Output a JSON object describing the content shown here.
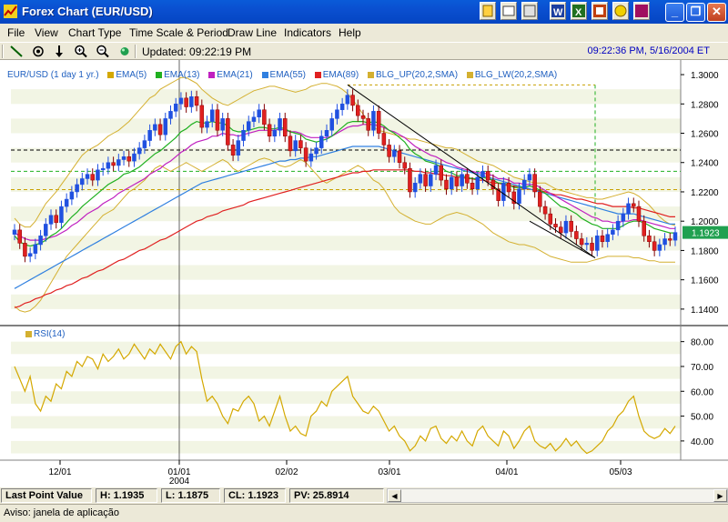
{
  "window": {
    "title": "Forex Chart (EUR/USD)"
  },
  "menu": [
    "File",
    "View",
    "Chart Type",
    "Time Scale & Period",
    "Draw Line",
    "Indicators",
    "Help"
  ],
  "toolbar": {
    "updated": "Updated: 09:22:19 PM",
    "clock": "09:22:36 PM, 5/16/2004 ET"
  },
  "legend": [
    {
      "label": "EUR/USD (1 day  1 yr.)",
      "color": "#2060c0"
    },
    {
      "label": "EMA(5)",
      "color": "#d4a800"
    },
    {
      "label": "EMA(13)",
      "color": "#20b020"
    },
    {
      "label": "EMA(21)",
      "color": "#c020c0"
    },
    {
      "label": "EMA(55)",
      "color": "#3080e0"
    },
    {
      "label": "EMA(89)",
      "color": "#e02020"
    },
    {
      "label": "BLG_UP(20,2,SMA)",
      "color": "#d4b030"
    },
    {
      "label": "BLG_LW(20,2,SMA)",
      "color": "#d4b030"
    }
  ],
  "rsi_label": "RSI(14)",
  "chart_data": [
    {
      "type": "line",
      "title": "EUR/USD (1 day  1 yr.)",
      "price_ticks": [
        "1.3000",
        "1.2800",
        "1.2600",
        "1.2400",
        "1.2200",
        "1.2000",
        "1.1800",
        "1.1600",
        "1.1400"
      ],
      "ylim": [
        1.13,
        1.305
      ],
      "current_price": "1.1923",
      "x_ticks": [
        "12/01",
        "01/01",
        "02/02",
        "03/01",
        "04/01",
        "05/03"
      ],
      "x_year": "2004",
      "close": [
        1.194,
        1.185,
        1.176,
        1.178,
        1.184,
        1.19,
        1.198,
        1.204,
        1.199,
        1.21,
        1.215,
        1.22,
        1.225,
        1.229,
        1.232,
        1.228,
        1.235,
        1.236,
        1.24,
        1.238,
        1.242,
        1.244,
        1.241,
        1.246,
        1.25,
        1.255,
        1.262,
        1.266,
        1.259,
        1.27,
        1.275,
        1.28,
        1.284,
        1.278,
        1.285,
        1.279,
        1.264,
        1.268,
        1.276,
        1.262,
        1.27,
        1.252,
        1.245,
        1.255,
        1.262,
        1.268,
        1.271,
        1.276,
        1.266,
        1.258,
        1.262,
        1.27,
        1.258,
        1.248,
        1.255,
        1.25,
        1.241,
        1.246,
        1.25,
        1.258,
        1.262,
        1.27,
        1.276,
        1.28,
        1.286,
        1.279,
        1.272,
        1.27,
        1.262,
        1.275,
        1.26,
        1.252,
        1.244,
        1.248,
        1.24,
        1.236,
        1.22,
        1.226,
        1.232,
        1.224,
        1.232,
        1.238,
        1.228,
        1.222,
        1.23,
        1.224,
        1.232,
        1.226,
        1.222,
        1.23,
        1.234,
        1.228,
        1.222,
        1.214,
        1.226,
        1.22,
        1.212,
        1.222,
        1.228,
        1.232,
        1.22,
        1.21,
        1.205,
        1.198,
        1.196,
        1.192,
        1.2,
        1.193,
        1.188,
        1.184,
        1.185,
        1.18,
        1.19,
        1.186,
        1.191,
        1.194,
        1.2,
        1.205,
        1.212,
        1.21,
        1.2,
        1.19,
        1.186,
        1.18,
        1.184,
        1.188,
        1.187,
        1.1923
      ],
      "ema13": [
        1.19,
        1.186,
        1.184,
        1.183,
        1.184,
        1.185,
        1.187,
        1.19,
        1.192,
        1.195,
        1.199,
        1.203,
        1.206,
        1.21,
        1.213,
        1.216,
        1.219,
        1.222,
        1.225,
        1.227,
        1.229,
        1.232,
        1.233,
        1.235,
        1.237,
        1.24,
        1.243,
        1.246,
        1.248,
        1.251,
        1.254,
        1.257,
        1.261,
        1.263,
        1.266,
        1.268,
        1.267,
        1.267,
        1.268,
        1.267,
        1.267,
        1.265,
        1.262,
        1.261,
        1.261,
        1.262,
        1.263,
        1.264,
        1.264,
        1.263,
        1.263,
        1.264,
        1.263,
        1.261,
        1.26,
        1.259,
        1.256,
        1.255,
        1.254,
        1.255,
        1.256,
        1.258,
        1.261,
        1.264,
        1.267,
        1.268,
        1.268,
        1.268,
        1.267,
        1.268,
        1.267,
        1.265,
        1.262,
        1.26,
        1.257,
        1.254,
        1.249,
        1.246,
        1.244,
        1.241,
        1.24,
        1.239,
        1.237,
        1.234,
        1.233,
        1.231,
        1.231,
        1.23,
        1.229,
        1.229,
        1.23,
        1.229,
        1.228,
        1.226,
        1.226,
        1.225,
        1.223,
        1.223,
        1.223,
        1.224,
        1.223,
        1.221,
        1.219,
        1.216,
        1.213,
        1.21,
        1.209,
        1.207,
        1.205,
        1.202,
        1.2,
        1.198,
        1.197,
        1.195,
        1.195,
        1.195,
        1.195,
        1.197,
        1.199,
        1.2,
        1.2,
        1.199,
        1.197,
        1.195,
        1.194,
        1.193,
        1.192,
        1.192
      ],
      "ema21": [
        1.192,
        1.19,
        1.188,
        1.187,
        1.187,
        1.187,
        1.188,
        1.189,
        1.19,
        1.192,
        1.194,
        1.197,
        1.199,
        1.202,
        1.205,
        1.207,
        1.209,
        1.212,
        1.214,
        1.216,
        1.219,
        1.221,
        1.223,
        1.225,
        1.227,
        1.229,
        1.232,
        1.234,
        1.236,
        1.239,
        1.241,
        1.244,
        1.247,
        1.249,
        1.252,
        1.254,
        1.255,
        1.256,
        1.258,
        1.258,
        1.26,
        1.259,
        1.259,
        1.258,
        1.259,
        1.26,
        1.261,
        1.262,
        1.262,
        1.262,
        1.262,
        1.263,
        1.262,
        1.261,
        1.261,
        1.26,
        1.258,
        1.257,
        1.257,
        1.257,
        1.257,
        1.258,
        1.26,
        1.262,
        1.264,
        1.265,
        1.265,
        1.266,
        1.266,
        1.266,
        1.265,
        1.264,
        1.262,
        1.261,
        1.259,
        1.257,
        1.254,
        1.251,
        1.249,
        1.247,
        1.245,
        1.244,
        1.242,
        1.24,
        1.239,
        1.237,
        1.236,
        1.235,
        1.234,
        1.233,
        1.233,
        1.232,
        1.231,
        1.229,
        1.229,
        1.228,
        1.226,
        1.226,
        1.225,
        1.225,
        1.225,
        1.223,
        1.221,
        1.219,
        1.217,
        1.215,
        1.213,
        1.211,
        1.209,
        1.207,
        1.205,
        1.203,
        1.202,
        1.2,
        1.2,
        1.199,
        1.199,
        1.2,
        1.2,
        1.201,
        1.201,
        1.2,
        1.199,
        1.198,
        1.197,
        1.196,
        1.195,
        1.195
      ],
      "ema55": [
        1.154,
        1.156,
        1.158,
        1.16,
        1.162,
        1.164,
        1.166,
        1.168,
        1.17,
        1.172,
        1.174,
        1.176,
        1.178,
        1.18,
        1.182,
        1.184,
        1.186,
        1.188,
        1.19,
        1.192,
        1.194,
        1.196,
        1.198,
        1.2,
        1.202,
        1.204,
        1.206,
        1.208,
        1.21,
        1.212,
        1.214,
        1.216,
        1.218,
        1.22,
        1.222,
        1.224,
        1.226,
        1.227,
        1.228,
        1.229,
        1.23,
        1.231,
        1.232,
        1.233,
        1.234,
        1.235,
        1.236,
        1.237,
        1.238,
        1.239,
        1.24,
        1.241,
        1.241,
        1.242,
        1.242,
        1.243,
        1.243,
        1.244,
        1.244,
        1.245,
        1.246,
        1.247,
        1.248,
        1.249,
        1.25,
        1.251,
        1.251,
        1.251,
        1.251,
        1.251,
        1.251,
        1.25,
        1.249,
        1.248,
        1.247,
        1.246,
        1.245,
        1.244,
        1.243,
        1.242,
        1.241,
        1.24,
        1.239,
        1.238,
        1.237,
        1.236,
        1.235,
        1.234,
        1.233,
        1.232,
        1.231,
        1.23,
        1.229,
        1.228,
        1.227,
        1.226,
        1.225,
        1.224,
        1.223,
        1.222,
        1.221,
        1.22,
        1.219,
        1.218,
        1.217,
        1.216,
        1.215,
        1.214,
        1.213,
        1.212,
        1.211,
        1.21,
        1.209,
        1.208,
        1.207,
        1.206,
        1.205,
        1.205,
        1.205,
        1.205,
        1.204,
        1.203,
        1.202,
        1.201,
        1.2,
        1.199,
        1.198,
        1.198
      ],
      "ema89": [
        1.141,
        1.142,
        1.144,
        1.145,
        1.147,
        1.148,
        1.15,
        1.151,
        1.153,
        1.154,
        1.156,
        1.157,
        1.159,
        1.161,
        1.162,
        1.164,
        1.166,
        1.167,
        1.169,
        1.171,
        1.173,
        1.174,
        1.176,
        1.178,
        1.18,
        1.181,
        1.183,
        1.185,
        1.187,
        1.188,
        1.19,
        1.192,
        1.194,
        1.196,
        1.198,
        1.2,
        1.201,
        1.203,
        1.204,
        1.205,
        1.207,
        1.208,
        1.209,
        1.21,
        1.211,
        1.213,
        1.214,
        1.215,
        1.216,
        1.217,
        1.218,
        1.219,
        1.22,
        1.221,
        1.222,
        1.223,
        1.224,
        1.225,
        1.226,
        1.227,
        1.228,
        1.229,
        1.23,
        1.231,
        1.232,
        1.233,
        1.233,
        1.234,
        1.234,
        1.235,
        1.235,
        1.235,
        1.235,
        1.235,
        1.235,
        1.235,
        1.235,
        1.234,
        1.234,
        1.233,
        1.233,
        1.232,
        1.232,
        1.231,
        1.231,
        1.23,
        1.23,
        1.229,
        1.229,
        1.228,
        1.228,
        1.227,
        1.226,
        1.226,
        1.225,
        1.224,
        1.224,
        1.223,
        1.222,
        1.222,
        1.221,
        1.221,
        1.22,
        1.219,
        1.218,
        1.218,
        1.217,
        1.216,
        1.215,
        1.215,
        1.214,
        1.213,
        1.212,
        1.212,
        1.211,
        1.21,
        1.21,
        1.21,
        1.21,
        1.209,
        1.209,
        1.208,
        1.207,
        1.206,
        1.205,
        1.204,
        1.203,
        1.203
      ],
      "bb_up": [
        1.202,
        1.198,
        1.196,
        1.196,
        1.2,
        1.206,
        1.212,
        1.216,
        1.22,
        1.225,
        1.23,
        1.235,
        1.24,
        1.245,
        1.248,
        1.25,
        1.252,
        1.255,
        1.258,
        1.26,
        1.262,
        1.265,
        1.268,
        1.272,
        1.276,
        1.28,
        1.284,
        1.286,
        1.29,
        1.292,
        1.294,
        1.296,
        1.298,
        1.298,
        1.296,
        1.294,
        1.29,
        1.287,
        1.284,
        1.282,
        1.28,
        1.279,
        1.281,
        1.283,
        1.285,
        1.287,
        1.289,
        1.29,
        1.291,
        1.292,
        1.292,
        1.291,
        1.29,
        1.289,
        1.288,
        1.289,
        1.29,
        1.292,
        1.293,
        1.294,
        1.294,
        1.293,
        1.292,
        1.29,
        1.287,
        1.283,
        1.278,
        1.273,
        1.268,
        1.264,
        1.262,
        1.261,
        1.26,
        1.259,
        1.258,
        1.257,
        1.256,
        1.256,
        1.255,
        1.254,
        1.253,
        1.252,
        1.251,
        1.25,
        1.25,
        1.249,
        1.247,
        1.245,
        1.243,
        1.241,
        1.24,
        1.239,
        1.238,
        1.236,
        1.234,
        1.232,
        1.23,
        1.229,
        1.228,
        1.227,
        1.226,
        1.226,
        1.226,
        1.224,
        1.222,
        1.221,
        1.22,
        1.219,
        1.218,
        1.217,
        1.216,
        1.216,
        1.215,
        1.215,
        1.216,
        1.217,
        1.218,
        1.219,
        1.22,
        1.219,
        1.217,
        1.214,
        1.211,
        1.207,
        1.203,
        1.2,
        1.198,
        1.197
      ],
      "bb_lw": [
        1.142,
        1.139,
        1.138,
        1.139,
        1.142,
        1.146,
        1.152,
        1.158,
        1.164,
        1.17,
        1.176,
        1.18,
        1.184,
        1.188,
        1.192,
        1.196,
        1.2,
        1.204,
        1.206,
        1.208,
        1.212,
        1.216,
        1.22,
        1.222,
        1.225,
        1.228,
        1.232,
        1.236,
        1.238,
        1.236,
        1.234,
        1.236,
        1.238,
        1.24,
        1.238,
        1.236,
        1.234,
        1.236,
        1.238,
        1.24,
        1.242,
        1.24,
        1.236,
        1.234,
        1.236,
        1.238,
        1.24,
        1.242,
        1.243,
        1.242,
        1.24,
        1.238,
        1.237,
        1.238,
        1.24,
        1.242,
        1.24,
        1.236,
        1.232,
        1.228,
        1.226,
        1.228,
        1.23,
        1.232,
        1.234,
        1.236,
        1.238,
        1.236,
        1.232,
        1.228,
        1.226,
        1.222,
        1.216,
        1.21,
        1.206,
        1.204,
        1.202,
        1.2,
        1.199,
        1.198,
        1.198,
        1.2,
        1.202,
        1.204,
        1.205,
        1.206,
        1.205,
        1.204,
        1.202,
        1.2,
        1.198,
        1.195,
        1.192,
        1.19,
        1.188,
        1.186,
        1.185,
        1.184,
        1.184,
        1.183,
        1.182,
        1.18,
        1.178,
        1.176,
        1.175,
        1.174,
        1.173,
        1.172,
        1.172,
        1.172,
        1.172,
        1.173,
        1.174,
        1.175,
        1.176,
        1.176,
        1.176,
        1.176,
        1.176,
        1.175,
        1.175,
        1.174,
        1.173,
        1.173,
        1.172,
        1.172,
        1.172,
        1.172
      ]
    },
    {
      "type": "line",
      "title": "RSI(14)",
      "rsi_ticks": [
        "80.00",
        "70.00",
        "60.00",
        "50.00",
        "40.00"
      ],
      "ylim": [
        33,
        85
      ],
      "values": [
        70,
        65,
        60,
        66,
        55,
        52,
        58,
        56,
        63,
        61,
        68,
        66,
        72,
        70,
        74,
        73,
        69,
        75,
        72,
        74,
        77,
        73,
        75,
        79,
        76,
        73,
        77,
        75,
        79,
        76,
        73,
        78,
        80,
        75,
        78,
        76,
        65,
        56,
        58,
        55,
        50,
        47,
        53,
        52,
        56,
        58,
        55,
        48,
        50,
        46,
        52,
        58,
        50,
        44,
        46,
        43,
        42,
        50,
        52,
        56,
        54,
        60,
        62,
        64,
        66,
        58,
        55,
        52,
        51,
        54,
        52,
        48,
        44,
        46,
        42,
        40,
        36,
        38,
        42,
        40,
        45,
        46,
        41,
        39,
        42,
        40,
        44,
        40,
        38,
        44,
        46,
        42,
        40,
        38,
        44,
        42,
        37,
        40,
        44,
        46,
        40,
        38,
        37,
        39,
        36,
        38,
        41,
        38,
        40,
        37,
        35,
        36,
        38,
        40,
        44,
        46,
        50,
        52,
        56,
        58,
        50,
        44,
        42,
        41,
        42,
        45,
        43,
        46
      ]
    }
  ],
  "status": {
    "last_point": "Last Point Value",
    "h": "H: 1.1935",
    "l": "L: 1.1875",
    "cl": "CL: 1.1923",
    "pv": "PV: 25.8914"
  },
  "warning": "Aviso: janela de aplicação"
}
